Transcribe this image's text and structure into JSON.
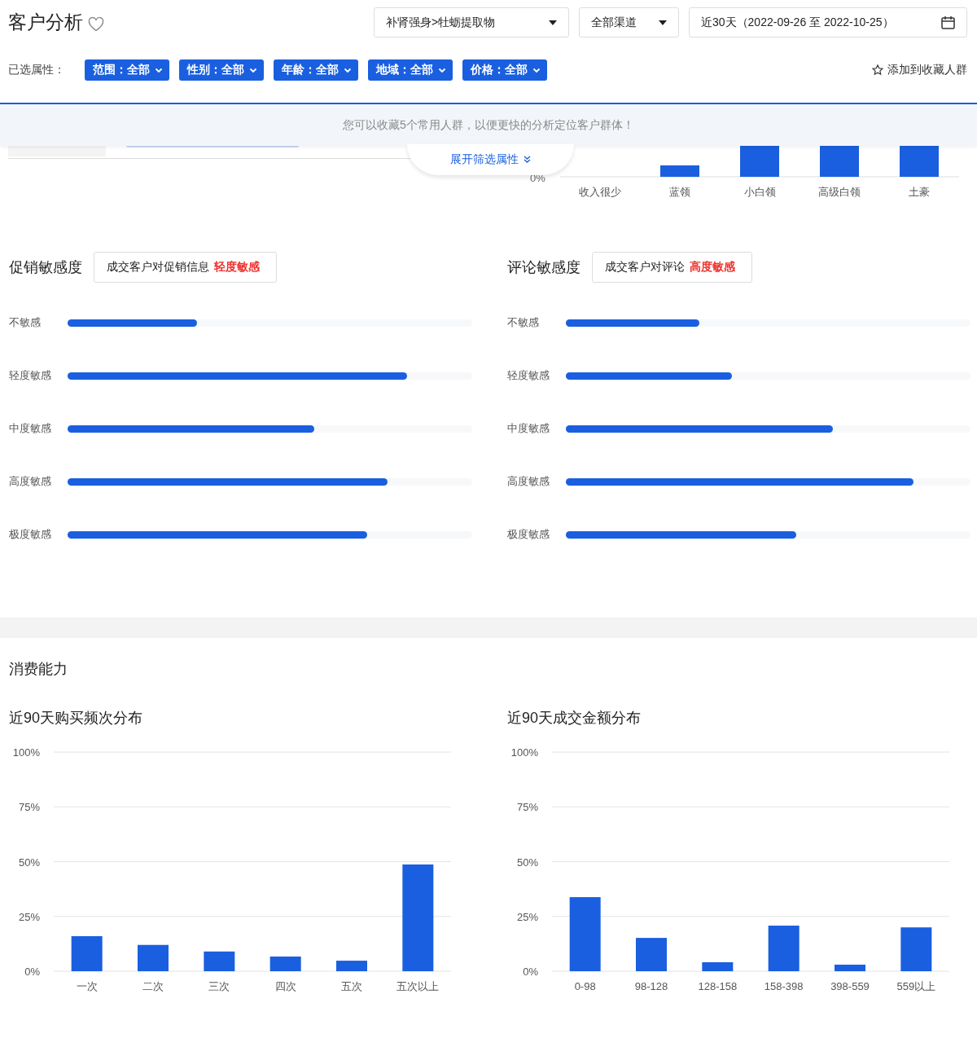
{
  "header": {
    "title": "客户分析",
    "category_select": "补肾强身>牡蛎提取物",
    "channel_select": "全部渠道",
    "date_range": "近30天（2022-09-26 至 2022-10-25）"
  },
  "filters": {
    "label": "已选属性：",
    "chips": [
      "范围：全部",
      "性别：全部",
      "年龄：全部",
      "地域：全部",
      "价格：全部"
    ],
    "favorite_link": "添加到收藏人群"
  },
  "notice": "您可以收藏5个常用人群，以便更快的分析定位客户群体！",
  "expand_button": "展开筛选属性",
  "income_chart": {
    "zero_tick": "0%",
    "categories": [
      "收入很少",
      "蓝领",
      "小白领",
      "高级白领",
      "土豪"
    ]
  },
  "sensitivity_panels": [
    {
      "title": "促销敏感度",
      "note": "成交客户对促销信息",
      "note_value": "轻度敏感",
      "rows": [
        {
          "label": "不敏感",
          "level": 0.32
        },
        {
          "label": "轻度敏感",
          "level": 0.84
        },
        {
          "label": "中度敏感",
          "level": 0.61
        },
        {
          "label": "高度敏感",
          "level": 0.79
        },
        {
          "label": "极度敏感",
          "level": 0.74
        }
      ]
    },
    {
      "title": "评论敏感度",
      "note": "成交客户对评论",
      "note_value": "高度敏感",
      "rows": [
        {
          "label": "不敏感",
          "level": 0.33
        },
        {
          "label": "轻度敏感",
          "level": 0.41
        },
        {
          "label": "中度敏感",
          "level": 0.66
        },
        {
          "label": "高度敏感",
          "level": 0.86
        },
        {
          "label": "极度敏感",
          "level": 0.57
        }
      ]
    }
  ],
  "spending": {
    "title": "消费能力",
    "charts": [
      {
        "title": "近90天购买频次分布",
        "chart_data": {
          "type": "bar",
          "grid": true,
          "categories": [
            "一次",
            "二次",
            "三次",
            "四次",
            "五次",
            "五次以上"
          ],
          "values": [
            16,
            12,
            9,
            6.7,
            4.8,
            48.7
          ],
          "ylim": [
            0,
            100
          ],
          "yticks": [
            {
              "value": 0,
              "label": "0%"
            },
            {
              "value": 25,
              "label": "25%"
            },
            {
              "value": 50,
              "label": "50%"
            },
            {
              "value": 75,
              "label": "75%"
            },
            {
              "value": 100,
              "label": "100%"
            }
          ]
        }
      },
      {
        "title": "近90天成交金额分布",
        "chart_data": {
          "type": "bar",
          "grid": true,
          "categories": [
            "0-98",
            "98-128",
            "128-158",
            "158-398",
            "398-559",
            "559以上"
          ],
          "values": [
            33.8,
            15.2,
            4.1,
            20.8,
            3,
            20
          ],
          "ylim": [
            0,
            100
          ],
          "yticks": [
            {
              "value": 0,
              "label": "0%"
            },
            {
              "value": 25,
              "label": "25%"
            },
            {
              "value": 50,
              "label": "50%"
            },
            {
              "value": 75,
              "label": "75%"
            },
            {
              "value": 100,
              "label": "100%"
            }
          ]
        }
      }
    ]
  }
}
